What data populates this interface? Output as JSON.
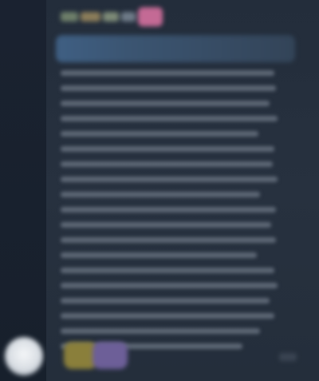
{
  "colors": {
    "rail": "#1a2230",
    "panel": "#27313f",
    "text_placeholder": "#5d6775",
    "banner": "#3f5f83",
    "accent_pink": "#c46a95",
    "reaction_yellow": "#8a7f3b",
    "reaction_purple": "#6d5f98"
  },
  "icons": {
    "avatar": "avatar",
    "reaction_1": "emoji-reaction",
    "reaction_2": "emoji-reaction"
  },
  "message": {
    "line_count": 19
  }
}
